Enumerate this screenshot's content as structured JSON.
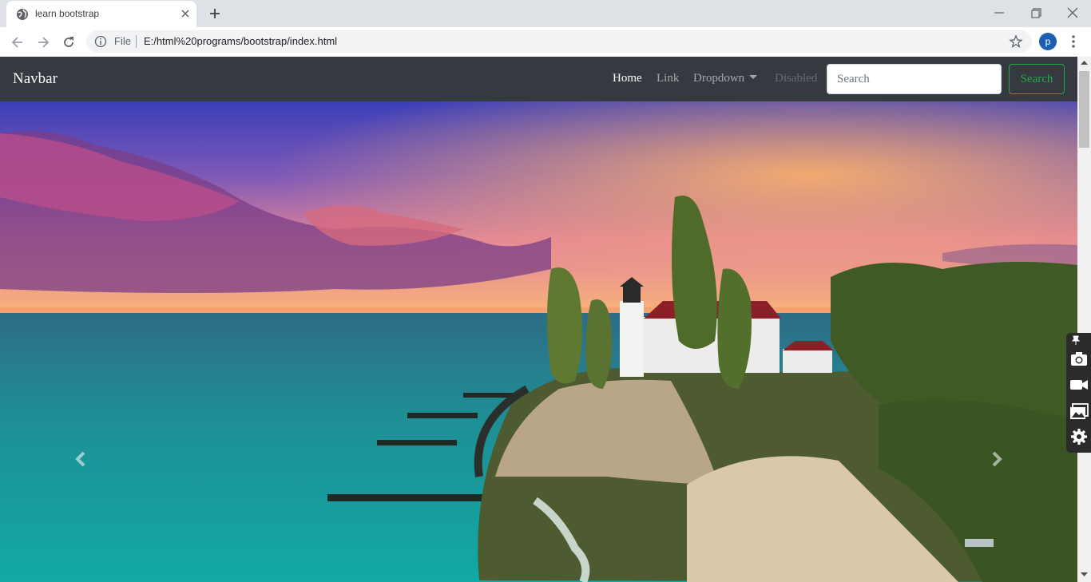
{
  "browser": {
    "tab_title": "learn bootstrap",
    "address": {
      "security_label": "File",
      "url": "E:/html%20programs/bootstrap/index.html"
    },
    "profile_initial": "p"
  },
  "navbar": {
    "brand": "Navbar",
    "links": [
      {
        "label": "Home",
        "state": "active"
      },
      {
        "label": "Link",
        "state": "normal"
      },
      {
        "label": "Dropdown",
        "state": "dropdown"
      },
      {
        "label": "Disabled",
        "state": "disabled"
      }
    ],
    "search_placeholder": "Search",
    "search_button": "Search",
    "colors": {
      "background": "#343a40",
      "success": "#28a745"
    }
  },
  "carousel": {
    "prev_icon": "chevron-left-icon",
    "next_icon": "chevron-right-icon"
  },
  "side_widget": {
    "icons": [
      "pin-icon",
      "camera-icon",
      "video-icon",
      "gallery-icon",
      "gear-icon"
    ]
  }
}
